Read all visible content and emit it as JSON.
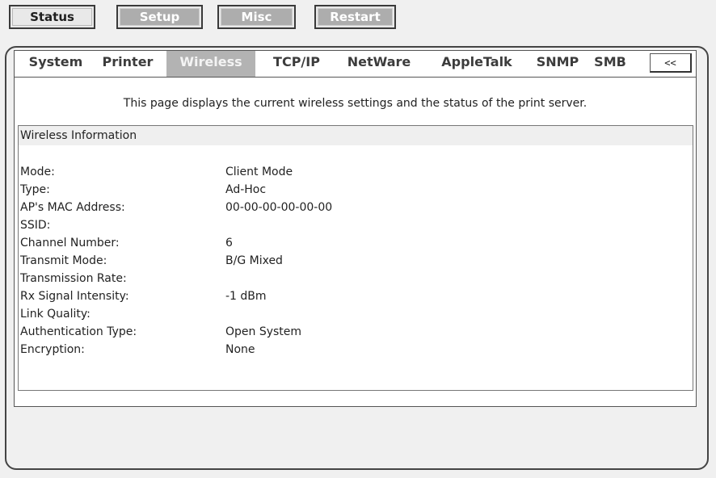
{
  "top_buttons": [
    {
      "label": "Status"
    },
    {
      "label": "Setup"
    },
    {
      "label": "Misc"
    },
    {
      "label": "Restart"
    }
  ],
  "tabs": [
    {
      "label": "System"
    },
    {
      "label": "Printer"
    },
    {
      "label": "Wireless"
    },
    {
      "label": "TCP/IP"
    },
    {
      "label": "NetWare"
    },
    {
      "label": "AppleTalk"
    },
    {
      "label": "SNMP"
    },
    {
      "label": "SMB"
    }
  ],
  "prev_button": "<<",
  "description": "This page displays the current wireless settings and the status of the print server.",
  "info": {
    "title": "Wireless Information",
    "rows": [
      {
        "label": "Mode:",
        "value": "Client Mode"
      },
      {
        "label": "Type:",
        "value": "Ad-Hoc"
      },
      {
        "label": "AP's MAC Address:",
        "value": "00-00-00-00-00-00"
      },
      {
        "label": "SSID:",
        "value": ""
      },
      {
        "label": "Channel Number:",
        "value": "6"
      },
      {
        "label": "Transmit Mode:",
        "value": "B/G Mixed"
      },
      {
        "label": "Transmission Rate:",
        "value": ""
      },
      {
        "label": "Rx Signal Intensity:",
        "value": "-1 dBm"
      },
      {
        "label": "Link Quality:",
        "value": ""
      },
      {
        "label": "Authentication Type:",
        "value": "Open System"
      },
      {
        "label": "Encryption:",
        "value": "None"
      }
    ]
  }
}
